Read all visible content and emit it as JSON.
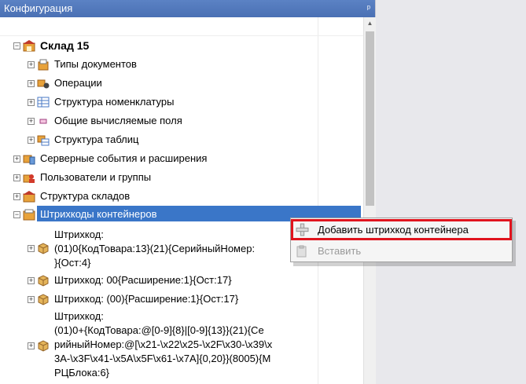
{
  "panel": {
    "title": "Конфигурация",
    "pin_glyph": "ᵖ"
  },
  "tree": {
    "root": {
      "label": "Склад 15"
    },
    "items": [
      {
        "label": "Типы документов"
      },
      {
        "label": "Операции"
      },
      {
        "label": "Структура номенклатуры"
      },
      {
        "label": "Общие вычисляемые поля"
      },
      {
        "label": "Структура таблиц"
      },
      {
        "label": "Серверные события и расширения"
      },
      {
        "label": "Пользователи и группы"
      },
      {
        "label": "Структура складов"
      },
      {
        "label": "Штрихкоды контейнеров"
      }
    ],
    "barcodes": [
      {
        "lines": [
          "Штрихкод:",
          "(01)0{КодТовара:13}(21){СерийныйНомер:",
          "}{Ост:4}"
        ]
      },
      {
        "lines": [
          "Штрихкод: 00{Расширение:1}{Ост:17}"
        ]
      },
      {
        "lines": [
          "Штрихкод: (00){Расширение:1}{Ост:17}"
        ]
      },
      {
        "lines": [
          "Штрихкод:",
          "(01)0+{КодТовара:@[0-9]{8}|[0-9]{13}}(21){Се",
          "рийныйНомер:@[\\x21-\\x22\\x25-\\x2F\\x30-\\x39\\x",
          "3A-\\x3F\\x41-\\x5A\\x5F\\x61-\\x7A]{0,20}}(8005){М",
          "РЦБлока:6}"
        ]
      }
    ]
  },
  "context_menu": {
    "add_label": "Добавить штрихкод контейнера",
    "paste_label": "Вставить"
  },
  "colors": {
    "title_bar": "#4a70b4",
    "selection": "#3a76c8",
    "highlight_border": "#e0141e"
  }
}
